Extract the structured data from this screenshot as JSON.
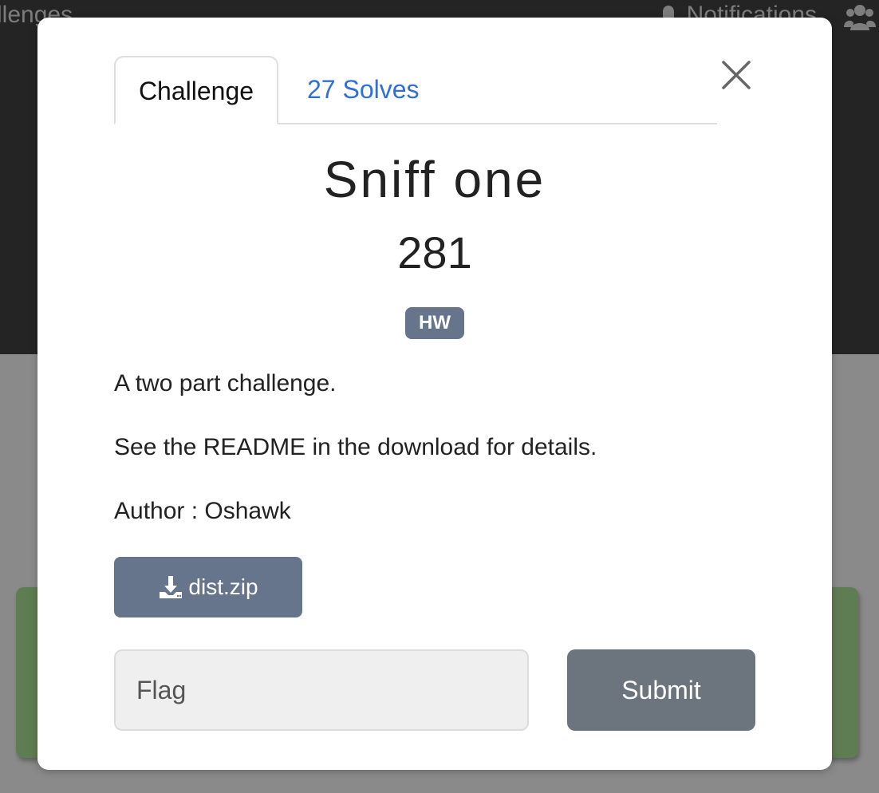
{
  "background": {
    "nav_left_text": "llenges",
    "nav_right_text": "Notifications"
  },
  "modal": {
    "tabs": [
      {
        "label": "Challenge"
      },
      {
        "label": "27 Solves"
      }
    ],
    "challenge": {
      "name": "Sniff one",
      "points": "281",
      "category_badge": "HW",
      "description": [
        "A two part challenge.",
        "See the README in the download for details.",
        "Author : Oshawk"
      ],
      "download_label": "dist.zip"
    },
    "flag_input": {
      "placeholder": "Flag",
      "value": ""
    },
    "submit_label": "Submit"
  },
  "colors": {
    "accent_blue": "#2f6fd9",
    "badge_bg": "#66758c",
    "submit_bg": "#6c757d",
    "background_card": "#5f7d52"
  }
}
